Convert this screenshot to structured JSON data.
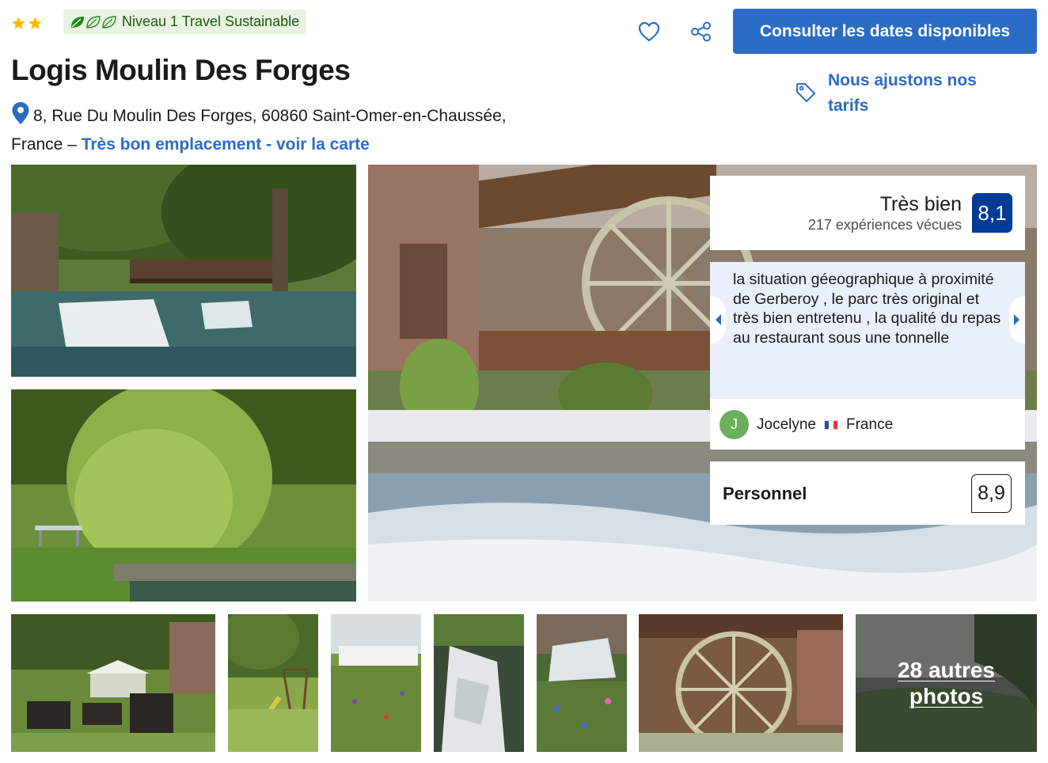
{
  "header": {
    "star_rating": 2,
    "sustainability_badge": "Niveau 1 Travel Sustainable",
    "sustainability_leaves_filled": 1,
    "sustainability_leaves_total": 3,
    "favorite_icon": "heart-icon",
    "share_icon": "share-icon",
    "cta_label": "Consulter les dates disponibles",
    "price_match_label": "Nous ajustons nos tarifs",
    "price_match_icon": "price-tag-icon"
  },
  "property": {
    "name": "Logis Moulin Des Forges",
    "address_line": "8, Rue Du Moulin Des Forges, 60860 Saint-Omer-en-Chaussée,",
    "address_country": "France – ",
    "location_link": "Très bon emplacement - voir la carte"
  },
  "rating": {
    "word": "Très bien",
    "count": "217 expériences vécues",
    "score": "8,1"
  },
  "review": {
    "text": "la situation géeographique à proximité de Gerberoy , le parc très original et très bien entretenu , la qualité du repas au restaurant sous une tonnelle",
    "author_initial": "J",
    "author_name": "Jocelyne",
    "author_country": "France"
  },
  "staff": {
    "label": "Personnel",
    "score": "8,9"
  },
  "gallery": {
    "more_photos_label": "28 autres photos"
  },
  "colors": {
    "brand_blue": "#2b6cc4",
    "score_navy": "#003b95",
    "star_yellow": "#febb02",
    "eco_green": "#1e5a12",
    "eco_bg": "#e8f3e1"
  }
}
